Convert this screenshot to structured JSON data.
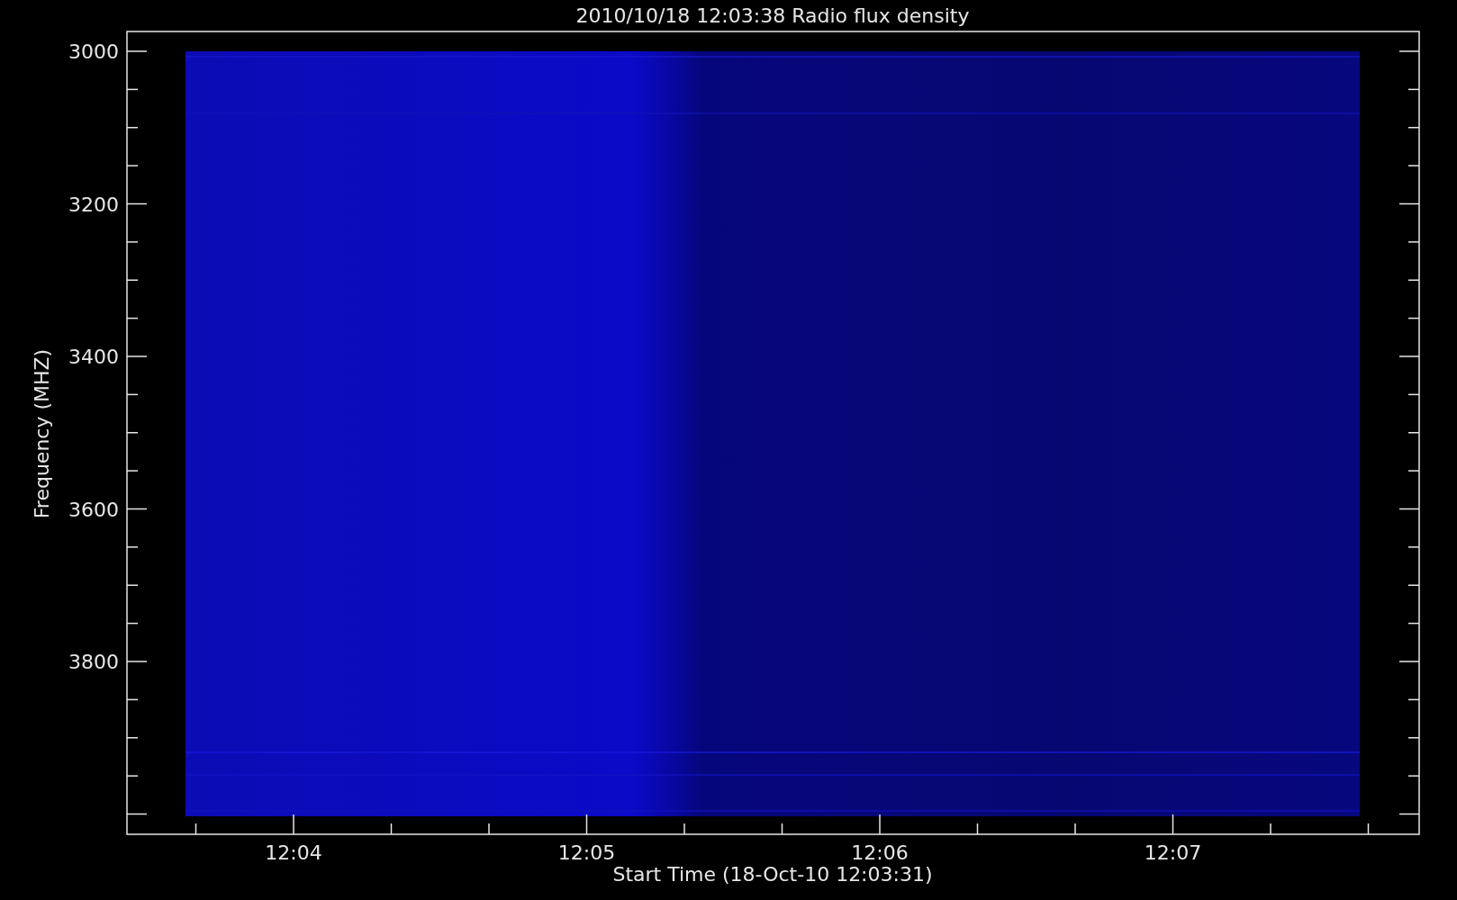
{
  "plot": {
    "title": "2010/10/18 12:03:38 Radio flux density",
    "xlabel": "Start Time (18-Oct-10 12:03:31)",
    "ylabel": "Frequency (MHZ)",
    "yticks": [
      "3000",
      "3200",
      "3400",
      "3600",
      "3800"
    ],
    "xticks": [
      "12:04",
      "12:05",
      "12:06",
      "12:07"
    ]
  }
}
